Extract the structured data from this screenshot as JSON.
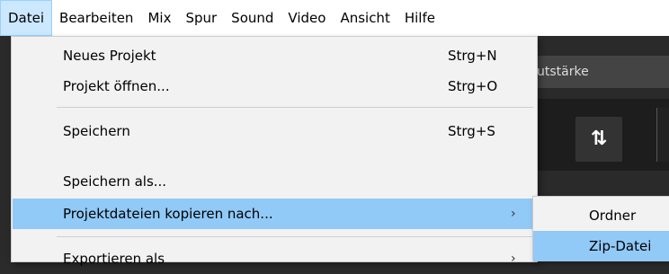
{
  "menubar": {
    "items": [
      {
        "label": "Datei"
      },
      {
        "label": "Bearbeiten"
      },
      {
        "label": "Mix"
      },
      {
        "label": "Spur"
      },
      {
        "label": "Sound"
      },
      {
        "label": "Video"
      },
      {
        "label": "Ansicht"
      },
      {
        "label": "Hilfe"
      }
    ]
  },
  "background": {
    "strip_label": "utstärke",
    "toolbar_glyph": "⇅",
    "ghost_glyph": "ʼ"
  },
  "file_menu": {
    "items": [
      {
        "label": "Neues Projekt",
        "shortcut": "Strg+N"
      },
      {
        "label": "Projekt öffnen...",
        "shortcut": "Strg+O"
      },
      {
        "label": "Speichern",
        "shortcut": "Strg+S"
      },
      {
        "label": "Speichern als..."
      },
      {
        "label": "Projektdateien kopieren nach...",
        "arrow": "›"
      },
      {
        "label": "Exportieren als",
        "arrow": "›"
      }
    ]
  },
  "submenu": {
    "items": [
      {
        "label": "Ordner"
      },
      {
        "label": "Zip-Datei"
      }
    ]
  },
  "colors": {
    "highlight": "#91c9f7",
    "menubar_active": "#cce8ff",
    "menu_bg": "#f2f2f2"
  }
}
